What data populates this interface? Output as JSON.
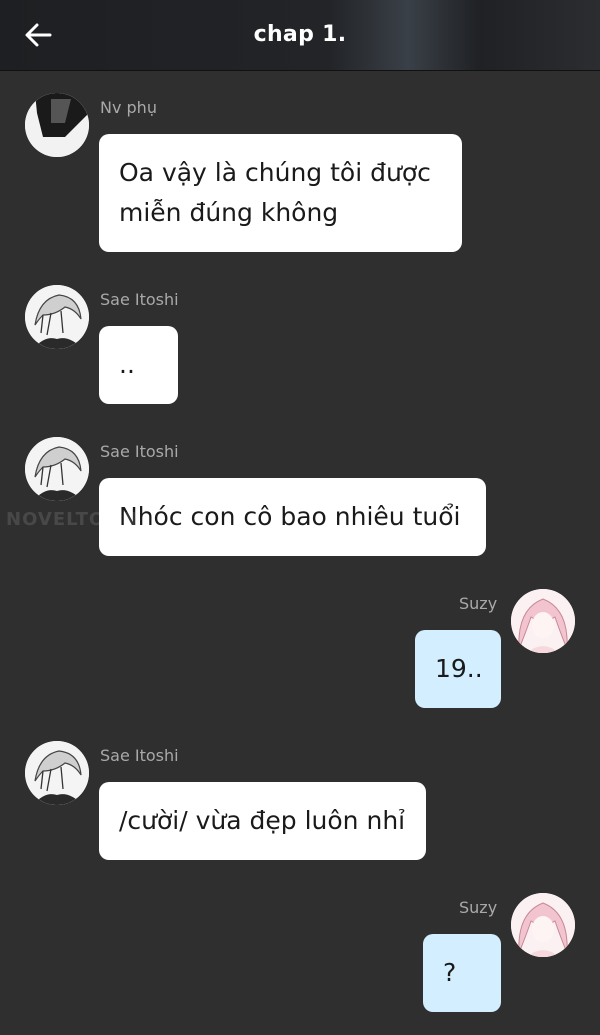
{
  "header": {
    "title": "chap 1.",
    "back_icon": "arrow-left-icon"
  },
  "watermark": "NOVELTOON",
  "messages": [
    {
      "sender": "Nv phụ",
      "text": "Oa vậy là chúng tôi được\nmiễn đúng không",
      "side": "left",
      "avatar": "dark-avatar"
    },
    {
      "sender": "Sae Itoshi",
      "text": "..",
      "side": "left",
      "avatar": "sae-avatar"
    },
    {
      "sender": "Sae Itoshi",
      "text": "Nhóc con cô bao nhiêu tuổi",
      "side": "left",
      "avatar": "sae-avatar"
    },
    {
      "sender": "Suzy",
      "text": "19..",
      "side": "right",
      "avatar": "suzy-avatar"
    },
    {
      "sender": "Sae Itoshi",
      "text": "/cười/ vừa đẹp luôn nhỉ",
      "side": "left",
      "avatar": "sae-avatar"
    },
    {
      "sender": "Suzy",
      "text": "?",
      "side": "right",
      "avatar": "suzy-avatar"
    }
  ],
  "colors": {
    "background": "#2f2f2f",
    "header": "#1e1f22",
    "bubble_other": "#ffffff",
    "bubble_me": "#d3efff",
    "sender_name": "#a9a9a9"
  }
}
